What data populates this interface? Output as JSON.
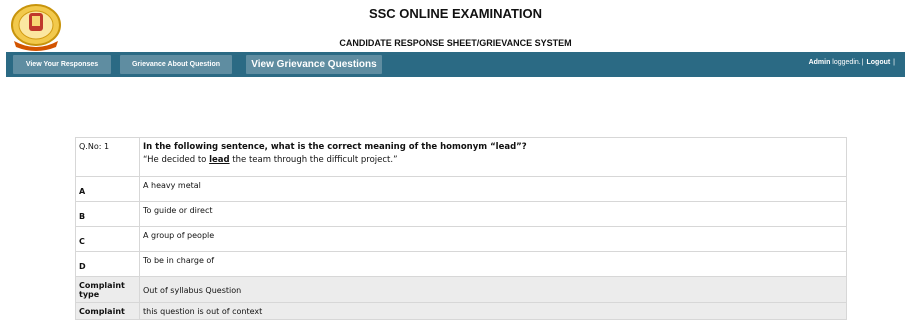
{
  "header": {
    "title": "SSC ONLINE EXAMINATION",
    "subtitle": "CANDIDATE RESPONSE SHEET/GRIEVANCE SYSTEM"
  },
  "nav": {
    "view_responses": "View Your Responses",
    "grievance_about_question": "Grievance About Question",
    "view_grievance_questions": "View Grievance Questions",
    "user": "Admin",
    "logged_in_text": "loggedin.",
    "separator": "|",
    "logout": "Logout",
    "trailing_separator": "|"
  },
  "question": {
    "qno_label": "Q.No: 1",
    "text": "In the following sentence, what is the correct meaning of the homonym “lead”?",
    "sentence_before": "“He decided to ",
    "sentence_highlight": "lead",
    "sentence_after": " the team through the difficult project.”",
    "options": [
      {
        "label": "A",
        "text": "A heavy metal"
      },
      {
        "label": "B",
        "text": "To guide or direct"
      },
      {
        "label": "C",
        "text": "A group of people"
      },
      {
        "label": "D",
        "text": "To be in charge of"
      }
    ],
    "complaint_type_label": "Complaint type",
    "complaint_type_value": "Out of syllabus Question",
    "complaint_label": "Complaint",
    "complaint_value": "this question is out of context"
  },
  "colors": {
    "navbar": "#2b6a84",
    "nav_button": "#5f8da1",
    "grey_row": "#ececec"
  }
}
